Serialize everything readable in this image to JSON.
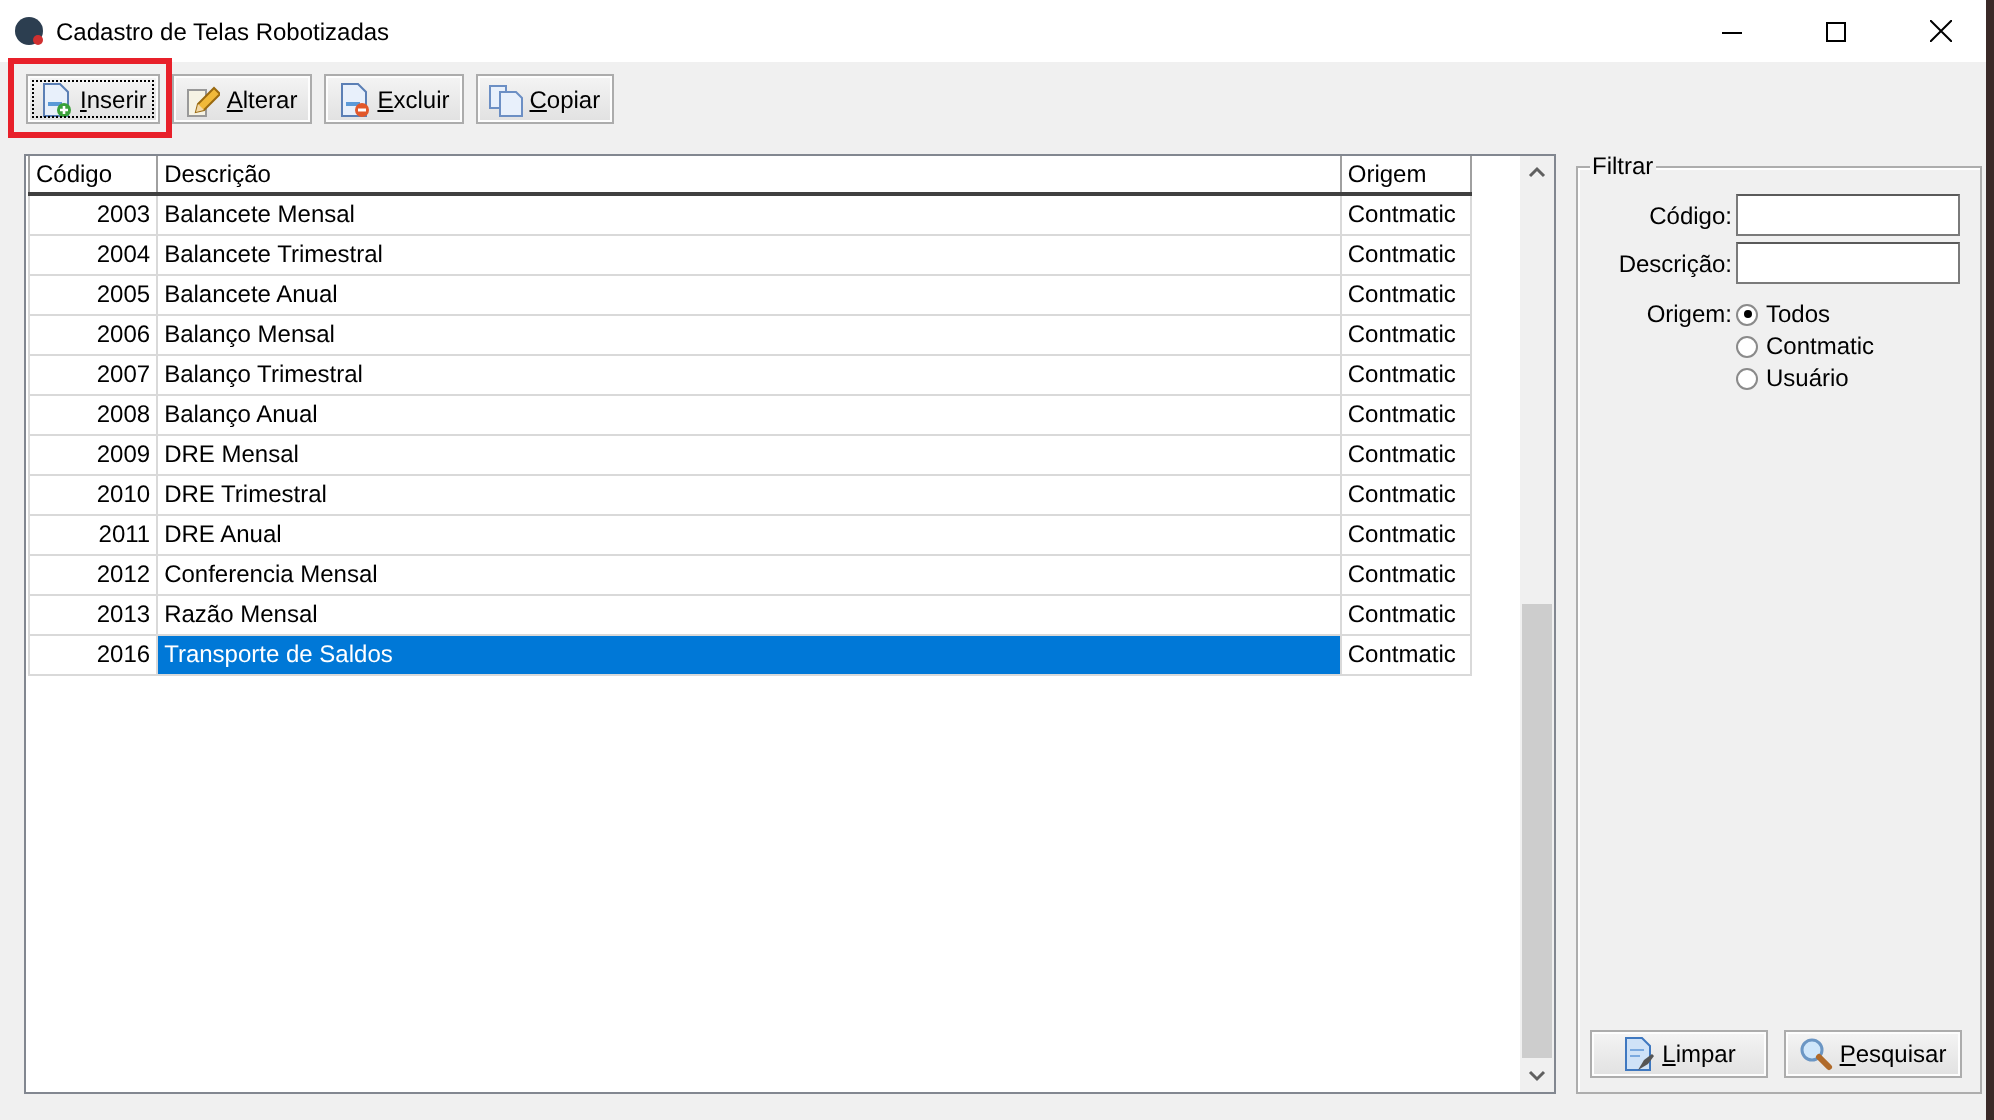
{
  "window": {
    "title": "Cadastro de Telas Robotizadas"
  },
  "toolbar": [
    {
      "label": "Inserir",
      "kind": "insert",
      "focused": true,
      "highlighted": true
    },
    {
      "label": "Alterar",
      "kind": "edit",
      "focused": false,
      "highlighted": false
    },
    {
      "label": "Excluir",
      "kind": "delete",
      "focused": false,
      "highlighted": false
    },
    {
      "label": "Copiar",
      "kind": "copy",
      "focused": false,
      "highlighted": false
    }
  ],
  "grid": {
    "columns": [
      "Código",
      "Descrição",
      "Origem"
    ],
    "rows": [
      {
        "cells": [
          "2003",
          "Balancete Mensal",
          "Contmatic"
        ],
        "selected": false
      },
      {
        "cells": [
          "2004",
          "Balancete Trimestral",
          "Contmatic"
        ],
        "selected": false
      },
      {
        "cells": [
          "2005",
          "Balancete Anual",
          "Contmatic"
        ],
        "selected": false
      },
      {
        "cells": [
          "2006",
          "Balanço Mensal",
          "Contmatic"
        ],
        "selected": false
      },
      {
        "cells": [
          "2007",
          "Balanço Trimestral",
          "Contmatic"
        ],
        "selected": false
      },
      {
        "cells": [
          "2008",
          "Balanço Anual",
          "Contmatic"
        ],
        "selected": false
      },
      {
        "cells": [
          "2009",
          "DRE Mensal",
          "Contmatic"
        ],
        "selected": false
      },
      {
        "cells": [
          "2010",
          "DRE Trimestral",
          "Contmatic"
        ],
        "selected": false
      },
      {
        "cells": [
          "2011",
          "DRE Anual",
          "Contmatic"
        ],
        "selected": false
      },
      {
        "cells": [
          "2012",
          "Conferencia Mensal",
          "Contmatic"
        ],
        "selected": false
      },
      {
        "cells": [
          "2013",
          "Razão Mensal",
          "Contmatic"
        ],
        "selected": false
      },
      {
        "cells": [
          "2016",
          "Transporte de Saldos",
          "Contmatic"
        ],
        "selected": true
      }
    ]
  },
  "filter": {
    "title": "Filtrar",
    "fields": [
      {
        "label": "Código:"
      },
      {
        "label": "Descrição:"
      }
    ],
    "origin": {
      "label": "Origem:",
      "options": [
        {
          "label": "Todos",
          "selected": true
        },
        {
          "label": "Contmatic",
          "selected": false
        },
        {
          "label": "Usuário",
          "selected": false
        }
      ]
    },
    "buttons": [
      {
        "label": "Limpar",
        "kind": "clear"
      },
      {
        "label": "Pesquisar",
        "kind": "search"
      }
    ]
  }
}
